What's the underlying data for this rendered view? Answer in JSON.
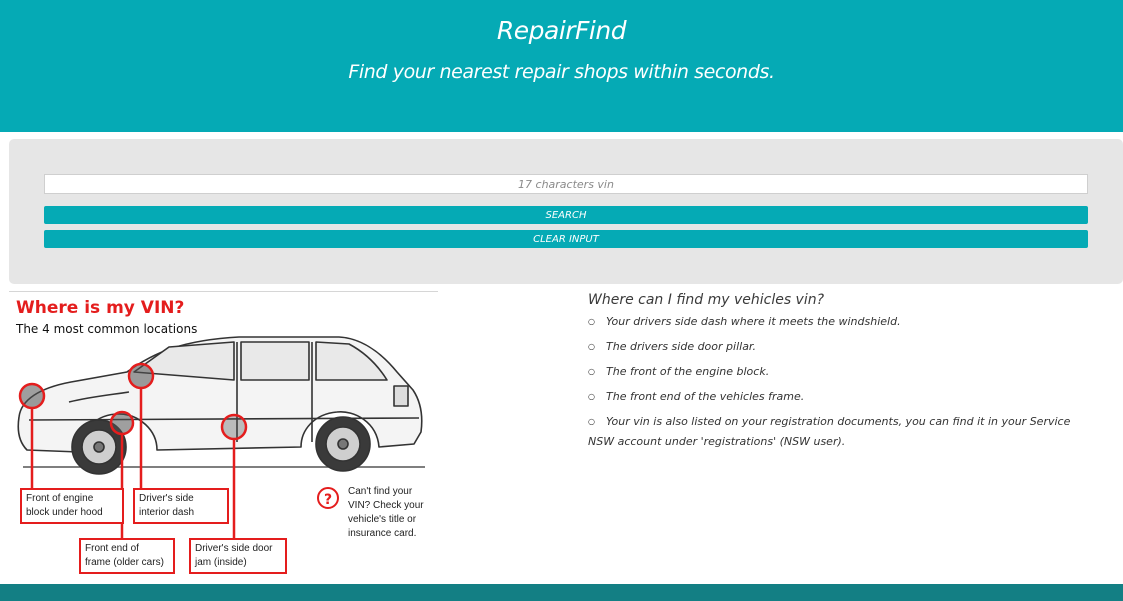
{
  "header": {
    "title": "RepairFind",
    "subtitle": "Find your nearest repair shops within seconds."
  },
  "search": {
    "vin_placeholder": "17 characters vin",
    "vin_value": "",
    "search_label": "SEARCH",
    "clear_label": "CLEAR INPUT"
  },
  "figure": {
    "heading": "Where is my VIN?",
    "subheading": "The 4 most common locations",
    "callouts": {
      "engine": [
        "Front of engine",
        "block under hood"
      ],
      "dash": [
        "Driver's side",
        "interior dash"
      ],
      "frame": [
        "Front end of",
        "frame (older cars)"
      ],
      "door": [
        "Driver's side door",
        "jam (inside)"
      ]
    },
    "help_icon": "?",
    "help_text": "Can't find your VIN? Check your vehicle's title or insurance card."
  },
  "info": {
    "question": "Where can I find my vehicles vin?",
    "items": [
      "Your drivers side dash where it meets the windshield.",
      "The drivers side door pillar.",
      "The front of the engine block.",
      "The front end of the vehicles frame.",
      "Your vin is also listed on your registration documents, you can find it in your Service NSW account under 'registrations' (NSW user)."
    ]
  },
  "colors": {
    "brand": "#05aab5",
    "panel": "#e6e6e6",
    "footer": "#137f84",
    "accent_red": "#e41d1d"
  }
}
